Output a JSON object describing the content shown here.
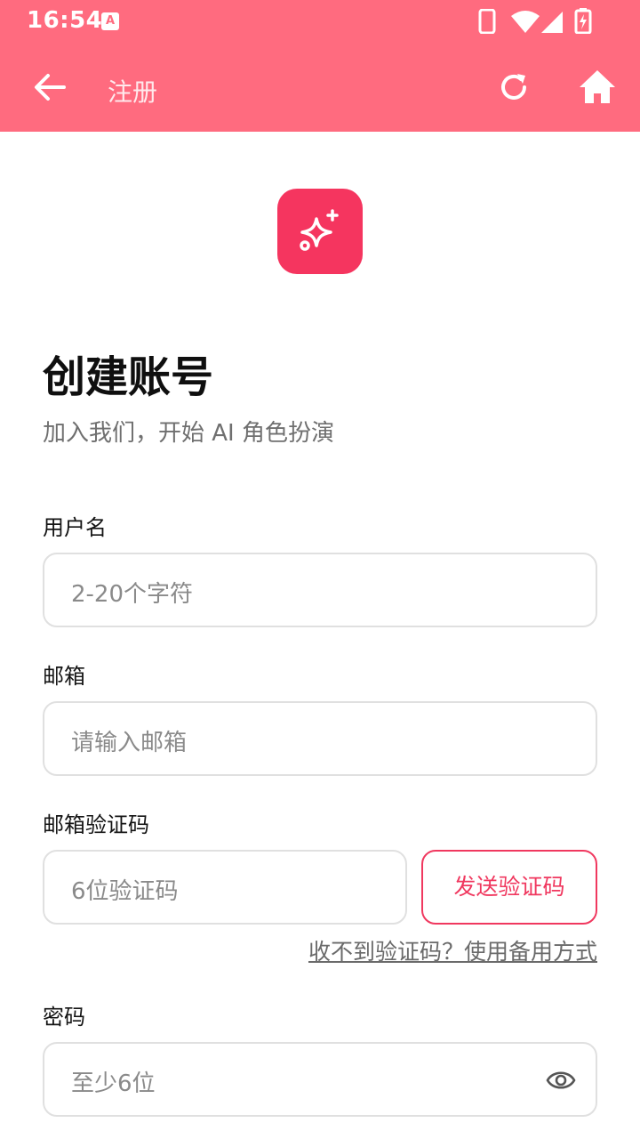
{
  "status_bar": {
    "time": "16:54",
    "app_badge": "A"
  },
  "app_bar": {
    "title": "注册"
  },
  "header": {
    "title": "创建账号",
    "subtitle": "加入我们，开始 AI 角色扮演"
  },
  "form": {
    "username": {
      "label": "用户名",
      "placeholder": "2-20个字符"
    },
    "email": {
      "label": "邮箱",
      "placeholder": "请输入邮箱"
    },
    "code": {
      "label": "邮箱验证码",
      "placeholder": "6位验证码",
      "send_button": "发送验证码",
      "fallback_link": "收不到验证码？使用备用方式"
    },
    "password": {
      "label": "密码",
      "placeholder": "至少6位"
    }
  },
  "colors": {
    "accent": "#ff6b7f",
    "brand": "#f5355f",
    "button_text": "#f0385f"
  },
  "icons": {
    "back": "arrow-left-icon",
    "refresh": "refresh-icon",
    "home": "home-icon",
    "logo": "sparkle-icon",
    "password_toggle": "eye-icon"
  }
}
